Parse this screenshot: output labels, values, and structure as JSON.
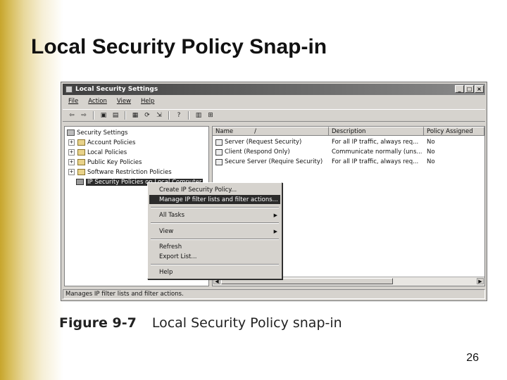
{
  "slide": {
    "title": "Local Security Policy Snap-in",
    "page_number": "26"
  },
  "window": {
    "title": "Local Security Settings",
    "controls": [
      "_",
      "□",
      "×"
    ],
    "menu": [
      "File",
      "Action",
      "View",
      "Help"
    ],
    "toolbar_icons": [
      "back-arrow-icon",
      "forward-arrow-icon",
      "up-folder-icon",
      "show-tree-icon",
      "properties-icon",
      "refresh-icon",
      "export-list-icon",
      "help-icon",
      "add-policy-icon",
      "manage-filters-icon"
    ],
    "tree": {
      "root": "Security Settings",
      "items": [
        {
          "label": "Account Policies",
          "expander": "+"
        },
        {
          "label": "Local Policies",
          "expander": "+"
        },
        {
          "label": "Public Key Policies",
          "expander": "+"
        },
        {
          "label": "Software Restriction Policies",
          "expander": "+"
        },
        {
          "label": "IP Security Policies on Local Computer",
          "expander": ""
        }
      ]
    },
    "list": {
      "columns": [
        "Name",
        "Description",
        "Policy Assigned"
      ],
      "sort_indicator": "/",
      "rows": [
        {
          "name": "Server (Request Security)",
          "description": "For all IP traffic, always req...",
          "assigned": "No"
        },
        {
          "name": "Client (Respond Only)",
          "description": "Communicate normally (uns...",
          "assigned": "No"
        },
        {
          "name": "Secure Server (Require Security)",
          "description": "For all IP traffic, always req...",
          "assigned": "No"
        }
      ]
    },
    "context_menu": {
      "items": [
        {
          "label": "Create IP Security Policy...",
          "highlighted": false,
          "submenu": false
        },
        {
          "label": "Manage IP filter lists and filter actions...",
          "highlighted": true,
          "submenu": false
        },
        {
          "label": "All Tasks",
          "highlighted": false,
          "submenu": true
        },
        {
          "label": "View",
          "highlighted": false,
          "submenu": true
        },
        {
          "label": "Refresh",
          "highlighted": false,
          "submenu": false
        },
        {
          "label": "Export List...",
          "highlighted": false,
          "submenu": false
        },
        {
          "label": "Help",
          "highlighted": false,
          "submenu": false
        }
      ],
      "submenu_arrow": "▶"
    },
    "status_text": "Manages IP filter lists and filter actions."
  },
  "caption": {
    "label": "Figure 9-7",
    "text": "Local Security Policy snap-in"
  },
  "colors": {
    "accent_gold": "#c7a52c",
    "selection": "#2b2b2b"
  }
}
